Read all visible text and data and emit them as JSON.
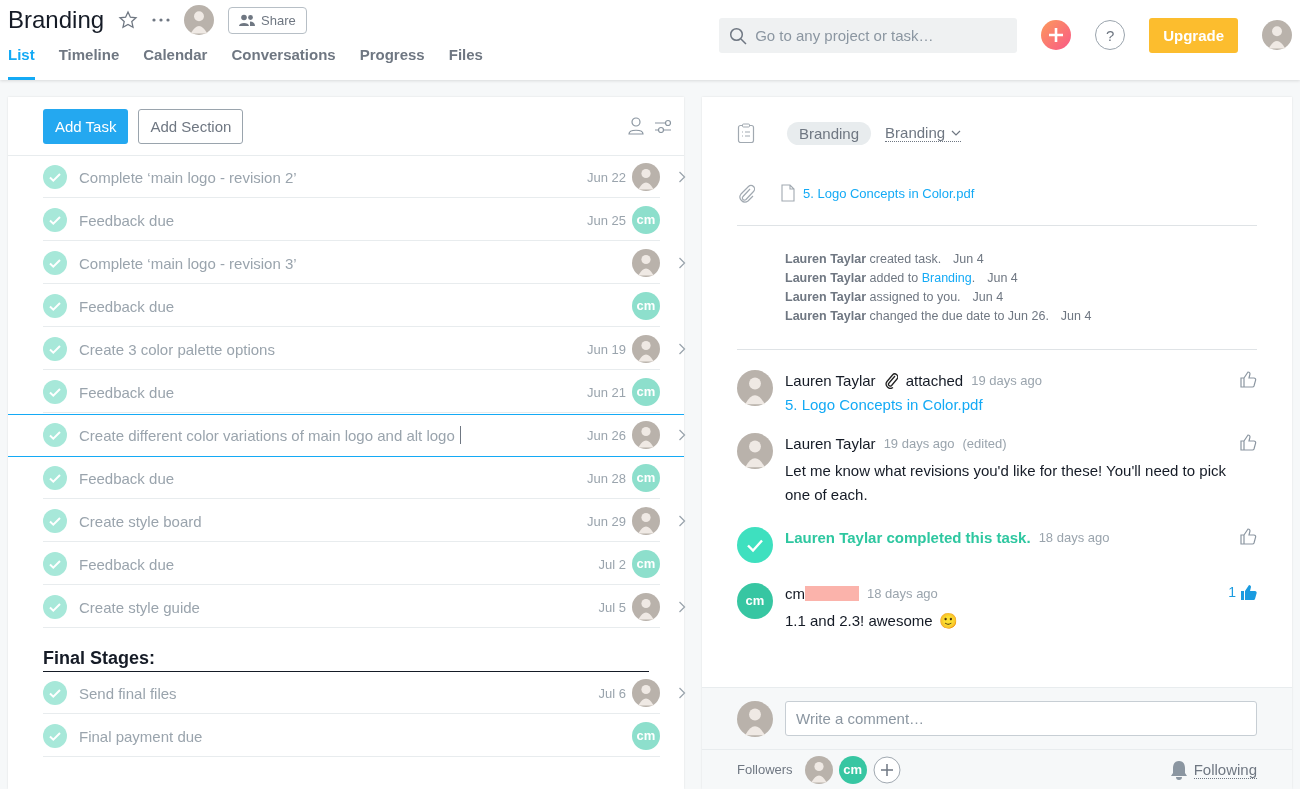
{
  "project": {
    "title": "Branding",
    "share_label": "Share"
  },
  "tabs": [
    {
      "label": "List",
      "selected": true
    },
    {
      "label": "Timeline",
      "selected": false
    },
    {
      "label": "Calendar",
      "selected": false
    },
    {
      "label": "Conversations",
      "selected": false
    },
    {
      "label": "Progress",
      "selected": false
    },
    {
      "label": "Files",
      "selected": false
    }
  ],
  "search": {
    "placeholder": "Go to any project or task…"
  },
  "help_label": "?",
  "upgrade_label": "Upgrade",
  "list": {
    "add_task": "Add Task",
    "add_section": "Add Section",
    "items": [
      {
        "kind": "task",
        "name": "Complete ‘main logo - revision 2’",
        "due": "Jun 22",
        "assignee": {
          "kind": "photo"
        },
        "has_subtasks": true,
        "checked": true,
        "selected": false
      },
      {
        "kind": "task",
        "name": "Feedback due",
        "due": "Jun 25",
        "assignee": {
          "kind": "initials",
          "initials": "cm"
        },
        "has_subtasks": false,
        "checked": true,
        "selected": false
      },
      {
        "kind": "task",
        "name": "Complete ‘main logo - revision 3’",
        "assignee": {
          "kind": "photo"
        },
        "has_subtasks": true,
        "checked": true,
        "selected": false
      },
      {
        "kind": "task",
        "name": "Feedback due",
        "assignee": {
          "kind": "initials",
          "initials": "cm"
        },
        "has_subtasks": false,
        "checked": true,
        "selected": false
      },
      {
        "kind": "task",
        "name": "Create 3 color palette options",
        "due": "Jun 19",
        "assignee": {
          "kind": "photo"
        },
        "has_subtasks": true,
        "checked": true,
        "selected": false
      },
      {
        "kind": "task",
        "name": "Feedback due",
        "due": "Jun 21",
        "assignee": {
          "kind": "initials",
          "initials": "cm"
        },
        "has_subtasks": false,
        "checked": true,
        "selected": false
      },
      {
        "kind": "task",
        "name": "Create different color variations of main logo and alt logo",
        "due": "Jun 26",
        "assignee": {
          "kind": "photo"
        },
        "has_subtasks": true,
        "checked": true,
        "selected": true
      },
      {
        "kind": "task",
        "name": "Feedback due",
        "due": "Jun 28",
        "assignee": {
          "kind": "initials",
          "initials": "cm"
        },
        "has_subtasks": false,
        "checked": true,
        "selected": false
      },
      {
        "kind": "task",
        "name": "Create style board",
        "due": "Jun 29",
        "assignee": {
          "kind": "photo"
        },
        "has_subtasks": true,
        "checked": true,
        "selected": false
      },
      {
        "kind": "task",
        "name": "Feedback due",
        "due": "Jul 2",
        "assignee": {
          "kind": "initials",
          "initials": "cm"
        },
        "has_subtasks": false,
        "checked": true,
        "selected": false
      },
      {
        "kind": "task",
        "name": "Create style guide",
        "due": "Jul 5",
        "assignee": {
          "kind": "photo"
        },
        "has_subtasks": true,
        "checked": true,
        "selected": false
      },
      {
        "kind": "section",
        "name": "Final Stages:"
      },
      {
        "kind": "task",
        "name": "Send final files",
        "due": "Jul 6",
        "assignee": {
          "kind": "photo"
        },
        "has_subtasks": true,
        "checked": true,
        "selected": false
      },
      {
        "kind": "task",
        "name": "Final payment due",
        "assignee": {
          "kind": "initials",
          "initials": "cm"
        },
        "has_subtasks": false,
        "checked": true,
        "selected": false
      }
    ]
  },
  "detail": {
    "project_tag": "Branding",
    "section_select": "Branding",
    "attachment": "5. Logo Concepts in Color.pdf",
    "activity": [
      {
        "actor": "Lauren Taylar",
        "action": "created task.",
        "date": "Jun 4"
      },
      {
        "actor": "Lauren Taylar",
        "action": "added to",
        "link": "Branding",
        "tail": ".",
        "date": "Jun 4"
      },
      {
        "actor": "Lauren Taylar",
        "action": "assigned to you.",
        "date": "Jun 4"
      },
      {
        "actor": "Lauren Taylar",
        "action": "changed the due date to Jun 26.",
        "date": "Jun 4"
      }
    ],
    "stories": [
      {
        "kind": "attachment",
        "author": "Lauren Taylar",
        "avatar": {
          "kind": "photo"
        },
        "verb": "attached",
        "time": "19 days ago",
        "file": "5. Logo Concepts in Color.pdf",
        "liked": false
      },
      {
        "kind": "comment",
        "author": "Lauren Taylar",
        "avatar": {
          "kind": "photo"
        },
        "time": "19 days ago",
        "edited": "(edited)",
        "text": "Let me know what revisions you'd like for these! You'll need to pick one of each.",
        "liked": false
      },
      {
        "kind": "completed",
        "text": "Lauren Taylar completed this task.",
        "time": "18 days ago",
        "liked": false
      },
      {
        "kind": "comment",
        "author": "cm",
        "author_redacted": true,
        "avatar": {
          "kind": "initials",
          "initials": "cm"
        },
        "time": "18 days ago",
        "text": "1.1 and 2.3! awesome",
        "emoji": "🙂",
        "likes": "1",
        "liked": true
      }
    ],
    "comment_placeholder": "Write a comment…",
    "followers_label": "Followers",
    "followers": [
      {
        "kind": "photo"
      },
      {
        "kind": "initials",
        "initials": "cm"
      }
    ],
    "following_label": "Following"
  }
}
